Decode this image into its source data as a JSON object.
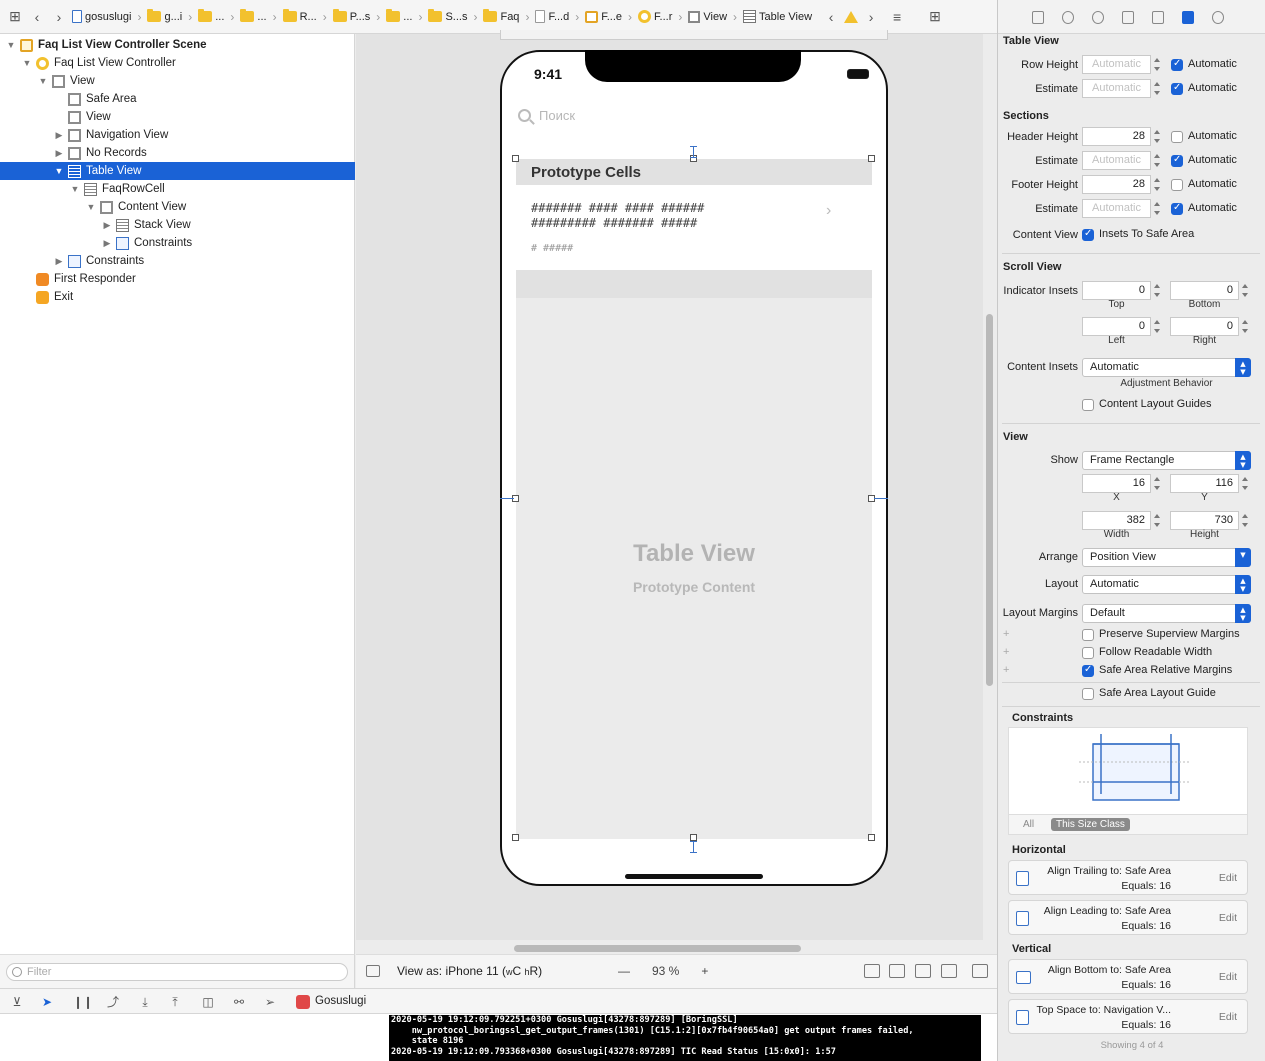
{
  "breadcrumbs": [
    "gosuslugi",
    "g...i",
    "...",
    "...",
    "R...",
    "P...s",
    "...",
    "S...s",
    "Faq",
    "F...d",
    "F...e",
    "F...r",
    "View",
    "Table View"
  ],
  "outline": {
    "items": [
      {
        "label": "Faq List View Controller Scene",
        "depth": 0,
        "icon": "scene-icon",
        "disclosure": "open"
      },
      {
        "label": "Faq List View Controller",
        "depth": 1,
        "icon": "view-controller-icon",
        "disclosure": "open"
      },
      {
        "label": "View",
        "depth": 2,
        "icon": "view-icon",
        "disclosure": "open"
      },
      {
        "label": "Safe Area",
        "depth": 3,
        "icon": "safe-area-icon",
        "disclosure": "none"
      },
      {
        "label": "View",
        "depth": 3,
        "icon": "view-icon",
        "disclosure": "none"
      },
      {
        "label": "Navigation View",
        "depth": 3,
        "icon": "view-icon",
        "disclosure": "closed"
      },
      {
        "label": "No Records",
        "depth": 3,
        "icon": "view-icon",
        "disclosure": "closed"
      },
      {
        "label": "Table View",
        "depth": 3,
        "icon": "table-view-icon",
        "disclosure": "open"
      },
      {
        "label": "FaqRowCell",
        "depth": 4,
        "icon": "table-cell-icon",
        "disclosure": "open"
      },
      {
        "label": "Content View",
        "depth": 5,
        "icon": "view-icon",
        "disclosure": "open"
      },
      {
        "label": "Stack View",
        "depth": 6,
        "icon": "stack-view-icon",
        "disclosure": "closed"
      },
      {
        "label": "Constraints",
        "depth": 6,
        "icon": "constraints-icon",
        "disclosure": "closed"
      },
      {
        "label": "Constraints",
        "depth": 3,
        "icon": "constraints-icon",
        "disclosure": "closed"
      },
      {
        "label": "First Responder",
        "depth": 1,
        "icon": "first-responder-icon",
        "disclosure": "none"
      },
      {
        "label": "Exit",
        "depth": 1,
        "icon": "exit-icon",
        "disclosure": "none"
      }
    ],
    "selected_index": 7,
    "filter_placeholder": "Filter"
  },
  "phone": {
    "time": "9:41",
    "search_placeholder": "Поиск",
    "section_title": "Prototype Cells",
    "cell_line1": "####### #### #### ######",
    "cell_line2": "######### ####### #####",
    "cell_sub": "# #####",
    "table_title": "Table View",
    "table_subtitle": "Prototype Content"
  },
  "canvas_bar": {
    "view_as_prefix": "View as: iPhone 11 (",
    "w_label": "w",
    "w_val": "C ",
    "h_label": "h",
    "h_val": "R)",
    "zoom_out": "—",
    "zoom": "93 %",
    "zoom_in": "+"
  },
  "debug": {
    "app_name": "Gosuslugi"
  },
  "console_lines": [
    "2020-05-19 19:12:09.792251+0300 Gosuslugi[43278:897289] [BoringSSL]",
    "    nw_protocol_boringssl_get_output_frames(1301) [C15.1:2][0x7fb4f90654a0] get output frames failed,",
    "    state 8196",
    "2020-05-19 19:12:09.793368+0300 Gosuslugi[43278:897289] TIC Read Status [15:0x0]: 1:57"
  ],
  "inspector": {
    "table_view": {
      "title": "Table View",
      "row_height_label": "Row Height",
      "row_height_value": "Automatic",
      "row_height_auto": true,
      "estimate_label": "Estimate",
      "estimate_value": "Automatic",
      "estimate_auto": true,
      "automatic_label": "Automatic"
    },
    "sections": {
      "title": "Sections",
      "header_height_label": "Header Height",
      "header_height": "28",
      "header_auto": false,
      "header_estimate": "Automatic",
      "header_estimate_auto": true,
      "footer_height_label": "Footer Height",
      "footer_height": "28",
      "footer_auto": false,
      "footer_estimate": "Automatic",
      "footer_estimate_auto": true,
      "content_view_label": "Content View",
      "insets_label": "Insets To Safe Area",
      "insets_on": true
    },
    "scroll_view": {
      "title": "Scroll View",
      "indicator_label": "Indicator Insets",
      "top": "0",
      "bottom": "0",
      "left": "0",
      "right": "0",
      "top_label": "Top",
      "bottom_label": "Bottom",
      "left_label": "Left",
      "right_label": "Right",
      "content_insets_label": "Content Insets",
      "content_insets": "Automatic",
      "adjustment_label": "Adjustment Behavior",
      "layout_guides_label": "Content Layout Guides",
      "layout_guides_on": false
    },
    "view": {
      "title": "View",
      "show_label": "Show",
      "show": "Frame Rectangle",
      "x": "16",
      "y": "116",
      "width": "382",
      "height": "730",
      "x_label": "X",
      "y_label": "Y",
      "width_label": "Width",
      "height_label": "Height",
      "arrange_label": "Arrange",
      "arrange": "Position View",
      "layout_label": "Layout",
      "layout": "Automatic",
      "margins_label": "Layout Margins",
      "margins": "Default",
      "preserve_label": "Preserve Superview Margins",
      "preserve_on": false,
      "readable_label": "Follow Readable Width",
      "readable_on": false,
      "safe_rel_label": "Safe Area Relative Margins",
      "safe_rel_on": true,
      "safe_guide_label": "Safe Area Layout Guide",
      "safe_guide_on": false
    },
    "constraints": {
      "title": "Constraints",
      "tab_all": "All",
      "tab_size": "This Size Class",
      "horizontal_title": "Horizontal",
      "vertical_title": "Vertical",
      "edit_label": "Edit",
      "items": [
        {
          "line1": "Align Trailing to:  Safe Area",
          "line2": "Equals:  16"
        },
        {
          "line1": "Align Leading to:  Safe Area",
          "line2": "Equals:  16"
        },
        {
          "line1": "Align Bottom to:  Safe Area",
          "line2": "Equals:  16"
        },
        {
          "line1": "Top Space to:  Navigation V...",
          "line2": "Equals:  16"
        }
      ],
      "showing": "Showing 4 of 4"
    }
  }
}
